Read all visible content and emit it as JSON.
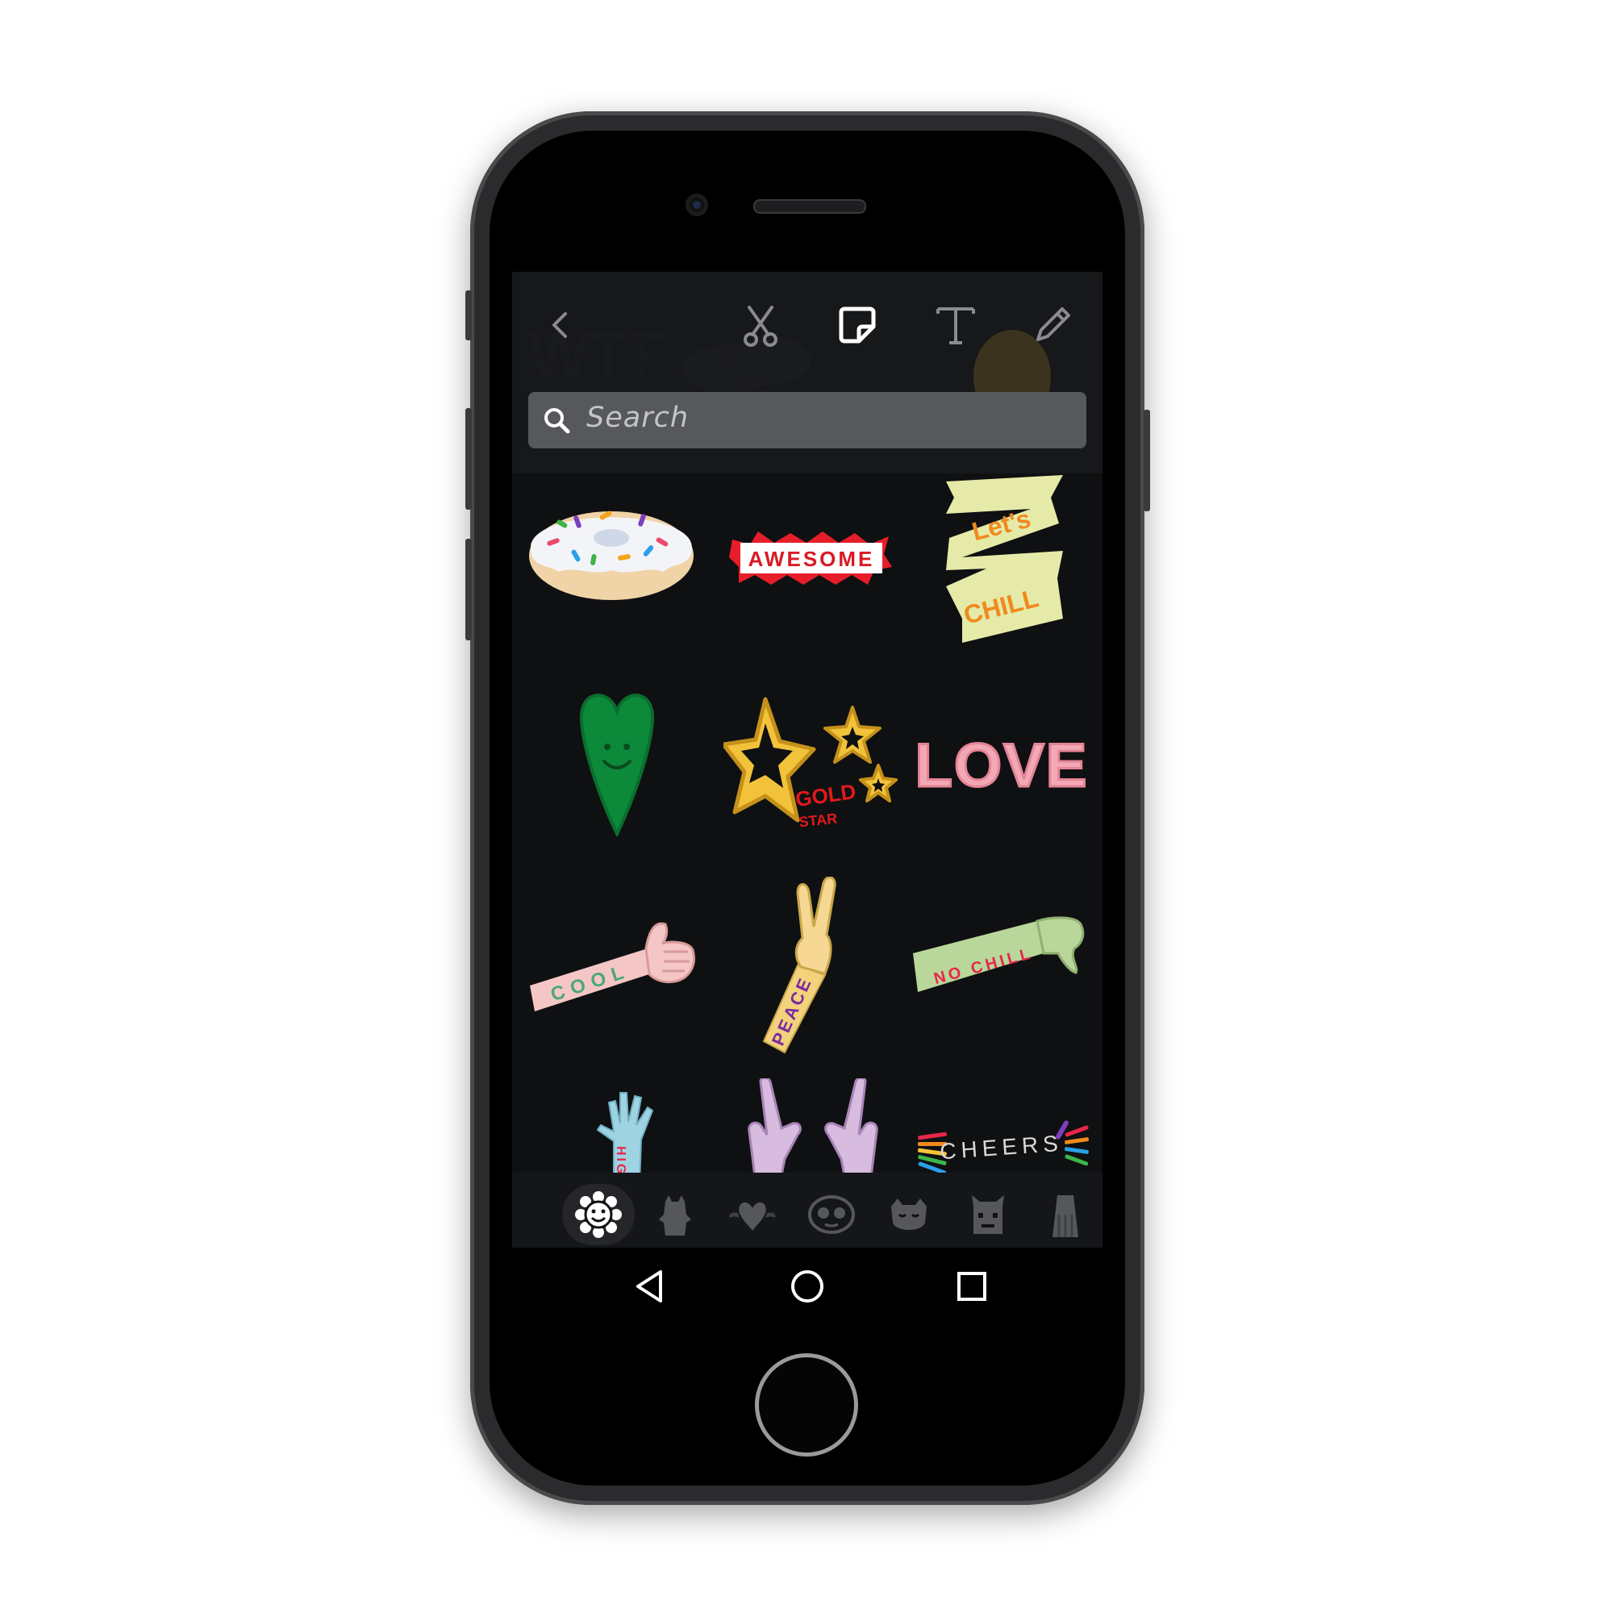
{
  "toolbar": {
    "back_icon": "chevron-left-icon",
    "tools": [
      "scissors-icon",
      "sticker-icon",
      "text-icon",
      "pencil-icon"
    ],
    "active_tool": "sticker-icon"
  },
  "search": {
    "placeholder": "Search"
  },
  "stickers": [
    {
      "name": "donut"
    },
    {
      "name": "awesome",
      "text": "AWESOME"
    },
    {
      "name": "lets-chill",
      "text_top": "Let's",
      "text_bottom": "CHILL"
    },
    {
      "name": "green-heart"
    },
    {
      "name": "gold-star",
      "text_top": "GOLD",
      "text_bottom": "STAR"
    },
    {
      "name": "love",
      "text": "LOVE"
    },
    {
      "name": "cool",
      "text": "COOL"
    },
    {
      "name": "peace",
      "text": "PEACE"
    },
    {
      "name": "no-chill",
      "text": "NO CHILL"
    },
    {
      "name": "high",
      "text": "HIGH"
    },
    {
      "name": "raise-hands"
    },
    {
      "name": "cheers",
      "text": "CHEERS"
    }
  ],
  "categories": [
    "flower-smiley-icon",
    "bear-icon",
    "winged-heart-icon",
    "face-icon",
    "sleepy-face-icon",
    "horned-creature-icon",
    "hairy-creature-icon"
  ],
  "active_category": "flower-smiley-icon",
  "nav": [
    "back-triangle-icon",
    "home-circle-icon",
    "recents-square-icon"
  ],
  "colors": {
    "screen_bg": "#0f1012",
    "search_bg": "#56585c",
    "phone_frame": "#2b2b2d"
  }
}
